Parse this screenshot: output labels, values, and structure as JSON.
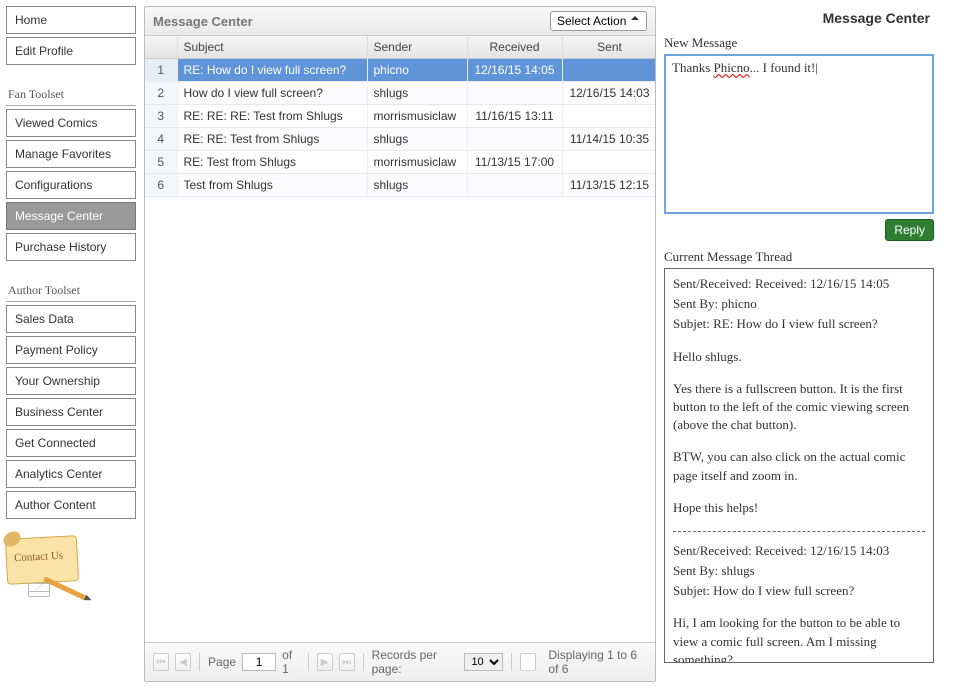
{
  "sidebar": {
    "top": [
      {
        "label": "Home"
      },
      {
        "label": "Edit Profile"
      }
    ],
    "fan_header": "Fan Toolset",
    "fan": [
      {
        "label": "Viewed Comics"
      },
      {
        "label": "Manage Favorites"
      },
      {
        "label": "Configurations"
      },
      {
        "label": "Message Center"
      },
      {
        "label": "Purchase History"
      }
    ],
    "author_header": "Author Toolset",
    "author": [
      {
        "label": "Sales Data"
      },
      {
        "label": "Payment Policy"
      },
      {
        "label": "Your Ownership"
      },
      {
        "label": "Business Center"
      },
      {
        "label": "Get Connected"
      },
      {
        "label": "Analytics Center"
      },
      {
        "label": "Author Content"
      }
    ],
    "contact_label": "Contact Us"
  },
  "grid": {
    "title": "Message Center",
    "action_placeholder": "Select Action",
    "columns": {
      "subject": "Subject",
      "sender": "Sender",
      "received": "Received",
      "sent": "Sent"
    },
    "rows": [
      {
        "n": "1",
        "subject": "RE: How do I view full screen?",
        "sender": "phicno",
        "received": "12/16/15 14:05",
        "sent": ""
      },
      {
        "n": "2",
        "subject": "How do I view full screen?",
        "sender": "shlugs",
        "received": "",
        "sent": "12/16/15 14:03"
      },
      {
        "n": "3",
        "subject": "RE: RE: RE: Test from Shlugs",
        "sender": "morrismusiclaw",
        "received": "11/16/15 13:11",
        "sent": ""
      },
      {
        "n": "4",
        "subject": "RE: RE: Test from Shlugs",
        "sender": "shlugs",
        "received": "",
        "sent": "11/14/15 10:35"
      },
      {
        "n": "5",
        "subject": "RE: Test from Shlugs",
        "sender": "morrismusiclaw",
        "received": "11/13/15 17:00",
        "sent": ""
      },
      {
        "n": "6",
        "subject": "Test from Shlugs",
        "sender": "shlugs",
        "received": "",
        "sent": "11/13/15 12:15"
      }
    ],
    "selected_index": 0,
    "pager": {
      "page_label_before": "Page",
      "page_current": "1",
      "page_label_after": "of 1",
      "records_label": "Records per page:",
      "records_value": "10",
      "display_text": "Displaying 1 to 6 of 6"
    }
  },
  "right": {
    "title": "Message Center",
    "new_label": "New Message",
    "compose_value_pre": "Thanks ",
    "compose_value_typo": "Phicno",
    "compose_value_post": "... I found it!",
    "reply_label": "Reply",
    "thread_label": "Current Message Thread",
    "thread": {
      "m1": {
        "line1": "Sent/Received: Received: 12/16/15 14:05",
        "line2": "Sent By: phicno",
        "line3": "Subjet: RE: How do I view full screen?",
        "p1": "Hello shlugs.",
        "p2": "Yes there is a fullscreen button.  It is the first button to the left of the comic viewing screen (above the chat button).",
        "p3": "BTW, you can also click on the actual comic page itself and zoom in.",
        "p4": "Hope this helps!"
      },
      "m2": {
        "line1": "Sent/Received: Received: 12/16/15 14:03",
        "line2": "Sent By: shlugs",
        "line3": "Subjet: How do I view full screen?",
        "p1": "Hi, I am looking for the button to be able to view a comic full screen.  Am I missing something?"
      }
    }
  }
}
